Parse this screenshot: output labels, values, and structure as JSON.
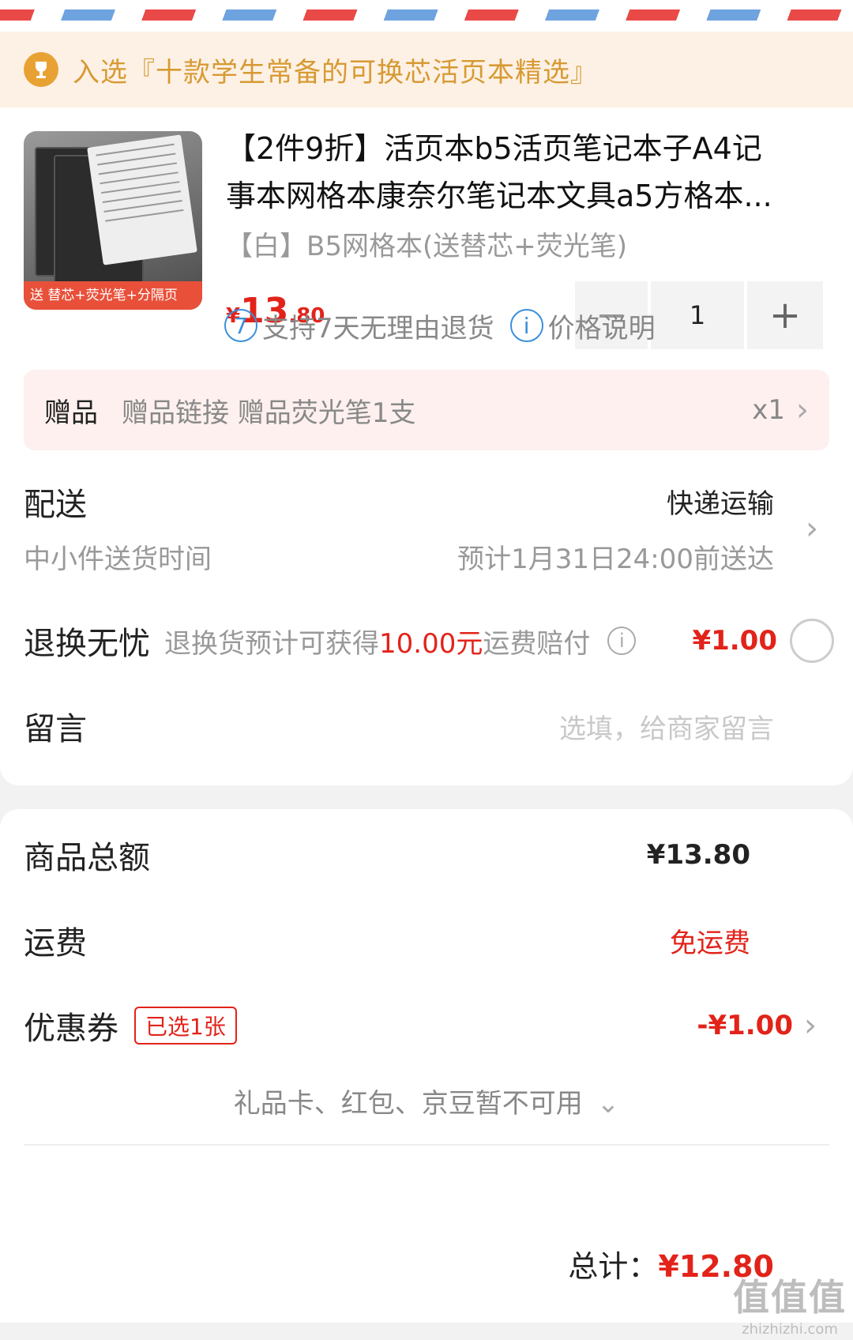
{
  "banner": {
    "text": "入选『十款学生常备的可换芯活页本精选』"
  },
  "product": {
    "image_caption": "送 替芯+荧光笔+分隔页",
    "title_line1": "【2件9折】活页本b5活页笔记本子A4记",
    "title_line2": "事本网格本康奈尔笔记本文具a5方格本...",
    "variant": "【白】B5网格本(送替芯+荧光笔)",
    "price_currency": "¥",
    "price_int": "13",
    "price_dec": ".80",
    "quantity": "1",
    "minus": "−",
    "plus": "+"
  },
  "guarantee": {
    "return_icon": "7",
    "return_text": "支持7天无理由退货",
    "price_icon": "i",
    "price_text": "价格说明"
  },
  "gift": {
    "tag": "赠品",
    "text": "赠品链接 赠品荧光笔1支",
    "qty": "x1"
  },
  "shipping": {
    "title": "配送",
    "method": "快递运输",
    "sub_left": "中小件送货时间",
    "sub_right": "预计1月31日24:00前送达"
  },
  "return_worry": {
    "title": "退换无忧",
    "desc_prefix": "退换货预计可获得",
    "desc_amount": "10.00元",
    "desc_suffix": "运费赔付",
    "info": "i",
    "price": "¥1.00"
  },
  "message": {
    "title": "留言",
    "placeholder": "选填，给商家留言"
  },
  "summary": {
    "goods_label": "商品总额",
    "goods_value": "¥13.80",
    "freight_label": "运费",
    "freight_value": "免运费",
    "coupon_label": "优惠券",
    "coupon_badge": "已选1张",
    "coupon_value": "-¥1.00",
    "unavailable": "礼品卡、红包、京豆暂不可用",
    "total_label": "总计：",
    "total_value": "¥12.80"
  },
  "watermark": {
    "big": "值值值",
    "small": "zhizhizhi.com"
  },
  "chevron": "›",
  "chevron_down": "⌄"
}
